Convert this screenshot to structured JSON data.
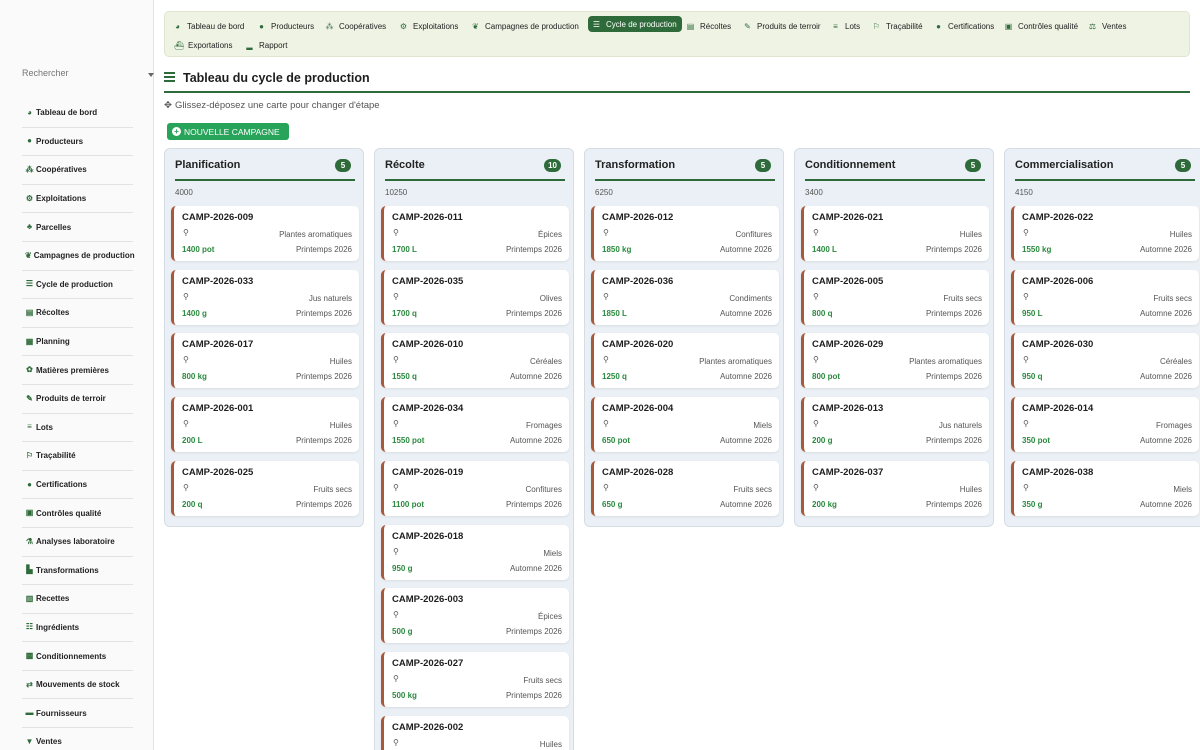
{
  "search": {
    "placeholder": "Rechercher"
  },
  "sidebar": {
    "items": [
      {
        "label": "Tableau de bord",
        "icon": "dashboard-icon",
        "glyph": "◕"
      },
      {
        "label": "Producteurs",
        "icon": "user-icon",
        "glyph": "●"
      },
      {
        "label": "Coopératives",
        "icon": "users-icon",
        "glyph": "⁂"
      },
      {
        "label": "Exploitations",
        "icon": "tractor-icon",
        "glyph": "⚙"
      },
      {
        "label": "Parcelles",
        "icon": "seedling-icon",
        "glyph": "♣"
      },
      {
        "label": "Campagnes de production",
        "icon": "leaf-icon",
        "glyph": "❦"
      },
      {
        "label": "Cycle de production",
        "icon": "bars-icon",
        "glyph": "☰"
      },
      {
        "label": "Récoltes",
        "icon": "box-icon",
        "glyph": "▤"
      },
      {
        "label": "Planning",
        "icon": "calendar-icon",
        "glyph": "▦"
      },
      {
        "label": "Matières premières",
        "icon": "sprout-icon",
        "glyph": "✿"
      },
      {
        "label": "Produits de terroir",
        "icon": "carrot-icon",
        "glyph": "✎"
      },
      {
        "label": "Lots",
        "icon": "list-icon",
        "glyph": "≡"
      },
      {
        "label": "Traçabilité",
        "icon": "route-icon",
        "glyph": "⚐"
      },
      {
        "label": "Certifications",
        "icon": "certificate-icon",
        "glyph": "●"
      },
      {
        "label": "Contrôles qualité",
        "icon": "clipboard-check-icon",
        "glyph": "▣"
      },
      {
        "label": "Analyses laboratoire",
        "icon": "flask-icon",
        "glyph": "⚗"
      },
      {
        "label": "Transformations",
        "icon": "industry-icon",
        "glyph": "▙"
      },
      {
        "label": "Recettes",
        "icon": "book-icon",
        "glyph": "▥"
      },
      {
        "label": "Ingrédients",
        "icon": "list-ul-icon",
        "glyph": "☷"
      },
      {
        "label": "Conditionnements",
        "icon": "boxes-icon",
        "glyph": "▩"
      },
      {
        "label": "Mouvements de stock",
        "icon": "exchange-icon",
        "glyph": "⇄"
      },
      {
        "label": "Fournisseurs",
        "icon": "truck-icon",
        "glyph": "▬"
      },
      {
        "label": "Ventes",
        "icon": "cart-icon",
        "glyph": "▼"
      }
    ]
  },
  "topmenu": {
    "items": [
      {
        "label": "Tableau de bord",
        "icon": "dashboard-icon",
        "glyph": "◕",
        "active": false
      },
      {
        "label": "Producteurs",
        "icon": "user-icon",
        "glyph": "●",
        "active": false
      },
      {
        "label": "Coopératives",
        "icon": "users-icon",
        "glyph": "⁂",
        "active": false
      },
      {
        "label": "Exploitations",
        "icon": "tractor-icon",
        "glyph": "⚙",
        "active": false
      },
      {
        "label": "Campagnes de production",
        "icon": "leaf-icon",
        "glyph": "❦",
        "active": false
      },
      {
        "label": "Cycle de production",
        "icon": "bars-icon",
        "glyph": "☰",
        "active": true
      },
      {
        "label": "Récoltes",
        "icon": "box-icon",
        "glyph": "▤",
        "active": false
      },
      {
        "label": "Produits de terroir",
        "icon": "carrot-icon",
        "glyph": "✎",
        "active": false
      },
      {
        "label": "Lots",
        "icon": "list-icon",
        "glyph": "≡",
        "active": false
      },
      {
        "label": "Traçabilité",
        "icon": "route-icon",
        "glyph": "⚐",
        "active": false
      },
      {
        "label": "Certifications",
        "icon": "certificate-icon",
        "glyph": "●",
        "active": false
      },
      {
        "label": "Contrôles qualité",
        "icon": "clipboard-check-icon",
        "glyph": "▣",
        "active": false
      },
      {
        "label": "Ventes",
        "icon": "sales-icon",
        "glyph": "⚖",
        "active": false
      },
      {
        "label": "Exportations",
        "icon": "ship-icon",
        "glyph": "⛴",
        "active": false
      },
      {
        "label": "Rapport",
        "icon": "chart-icon",
        "glyph": "▂",
        "active": false
      }
    ]
  },
  "page": {
    "title": "Tableau du cycle de production",
    "hint": "Glissez-déposez une carte pour changer d'étape",
    "new_button": "NOUVELLE CAMPAGNE"
  },
  "colors": {
    "primary": "#2f6b3a",
    "success": "#28a35a",
    "qty": "#2a8a3e",
    "card_border": "#a8593a"
  },
  "columns": [
    {
      "title": "Planification",
      "count": "5",
      "total": "4000",
      "cards": [
        {
          "code": "CAMP-2026-009",
          "category": "Plantes aromatiques",
          "quantity": "1400 pot",
          "season": "Printemps 2026"
        },
        {
          "code": "CAMP-2026-033",
          "category": "Jus naturels",
          "quantity": "1400 g",
          "season": "Printemps 2026"
        },
        {
          "code": "CAMP-2026-017",
          "category": "Huiles",
          "quantity": "800 kg",
          "season": "Printemps 2026"
        },
        {
          "code": "CAMP-2026-001",
          "category": "Huiles",
          "quantity": "200 L",
          "season": "Printemps 2026"
        },
        {
          "code": "CAMP-2026-025",
          "category": "Fruits secs",
          "quantity": "200 q",
          "season": "Printemps 2026"
        }
      ]
    },
    {
      "title": "Récolte",
      "count": "10",
      "total": "10250",
      "cards": [
        {
          "code": "CAMP-2026-011",
          "category": "Épices",
          "quantity": "1700 L",
          "season": "Printemps 2026"
        },
        {
          "code": "CAMP-2026-035",
          "category": "Olives",
          "quantity": "1700 q",
          "season": "Printemps 2026"
        },
        {
          "code": "CAMP-2026-010",
          "category": "Céréales",
          "quantity": "1550 q",
          "season": "Automne 2026"
        },
        {
          "code": "CAMP-2026-034",
          "category": "Fromages",
          "quantity": "1550 pot",
          "season": "Automne 2026"
        },
        {
          "code": "CAMP-2026-019",
          "category": "Confitures",
          "quantity": "1100 pot",
          "season": "Printemps 2026"
        },
        {
          "code": "CAMP-2026-018",
          "category": "Miels",
          "quantity": "950 g",
          "season": "Automne 2026"
        },
        {
          "code": "CAMP-2026-003",
          "category": "Épices",
          "quantity": "500 g",
          "season": "Printemps 2026"
        },
        {
          "code": "CAMP-2026-027",
          "category": "Fruits secs",
          "quantity": "500 kg",
          "season": "Printemps 2026"
        },
        {
          "code": "CAMP-2026-002",
          "category": "Huiles",
          "quantity": "",
          "season": ""
        }
      ]
    },
    {
      "title": "Transformation",
      "count": "5",
      "total": "6250",
      "cards": [
        {
          "code": "CAMP-2026-012",
          "category": "Confitures",
          "quantity": "1850 kg",
          "season": "Automne 2026"
        },
        {
          "code": "CAMP-2026-036",
          "category": "Condiments",
          "quantity": "1850 L",
          "season": "Automne 2026"
        },
        {
          "code": "CAMP-2026-020",
          "category": "Plantes aromatiques",
          "quantity": "1250 q",
          "season": "Automne 2026"
        },
        {
          "code": "CAMP-2026-004",
          "category": "Miels",
          "quantity": "650 pot",
          "season": "Automne 2026"
        },
        {
          "code": "CAMP-2026-028",
          "category": "Fruits secs",
          "quantity": "650 g",
          "season": "Automne 2026"
        }
      ]
    },
    {
      "title": "Conditionnement",
      "count": "5",
      "total": "3400",
      "cards": [
        {
          "code": "CAMP-2026-021",
          "category": "Huiles",
          "quantity": "1400 L",
          "season": "Printemps 2026"
        },
        {
          "code": "CAMP-2026-005",
          "category": "Fruits secs",
          "quantity": "800 q",
          "season": "Printemps 2026"
        },
        {
          "code": "CAMP-2026-029",
          "category": "Plantes aromatiques",
          "quantity": "800 pot",
          "season": "Printemps 2026"
        },
        {
          "code": "CAMP-2026-013",
          "category": "Jus naturels",
          "quantity": "200 g",
          "season": "Printemps 2026"
        },
        {
          "code": "CAMP-2026-037",
          "category": "Huiles",
          "quantity": "200 kg",
          "season": "Printemps 2026"
        }
      ]
    },
    {
      "title": "Commercialisation",
      "count": "5",
      "total": "4150",
      "cards": [
        {
          "code": "CAMP-2026-022",
          "category": "Huiles",
          "quantity": "1550 kg",
          "season": "Automne 2026"
        },
        {
          "code": "CAMP-2026-006",
          "category": "Fruits secs",
          "quantity": "950 L",
          "season": "Automne 2026"
        },
        {
          "code": "CAMP-2026-030",
          "category": "Céréales",
          "quantity": "950 q",
          "season": "Automne 2026"
        },
        {
          "code": "CAMP-2026-014",
          "category": "Fromages",
          "quantity": "350 pot",
          "season": "Automne 2026"
        },
        {
          "code": "CAMP-2026-038",
          "category": "Miels",
          "quantity": "350 g",
          "season": "Automne 2026"
        }
      ]
    }
  ]
}
